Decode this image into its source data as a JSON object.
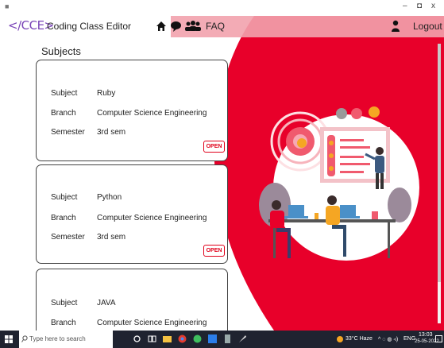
{
  "app": {
    "logo": "</CCE>",
    "title": "Coding Class Editor"
  },
  "nav": {
    "faq": "FAQ",
    "logout": "Logout"
  },
  "window": {
    "min": "–",
    "max": "◘",
    "close": "x"
  },
  "subjects_heading": "Subjects",
  "labels": {
    "subject": "Subject",
    "branch": "Branch",
    "semester": "Semester"
  },
  "cards": [
    {
      "subject": "Ruby",
      "branch": "Computer Science Engineering",
      "semester": "3rd sem",
      "open": "OPEN"
    },
    {
      "subject": "Python",
      "branch": "Computer Science Engineering",
      "semester": "3rd sem",
      "open": "OPEN"
    },
    {
      "subject": "JAVA",
      "branch": "Computer Science Engineering"
    }
  ],
  "taskbar": {
    "search_placeholder": "Type here to search",
    "weather": "33°C Haze",
    "lang": "ENG",
    "time": "13:03",
    "date": "25-05-2022"
  },
  "colors": {
    "accent_red": "#e8002a",
    "logo_purple": "#7a45b8"
  }
}
